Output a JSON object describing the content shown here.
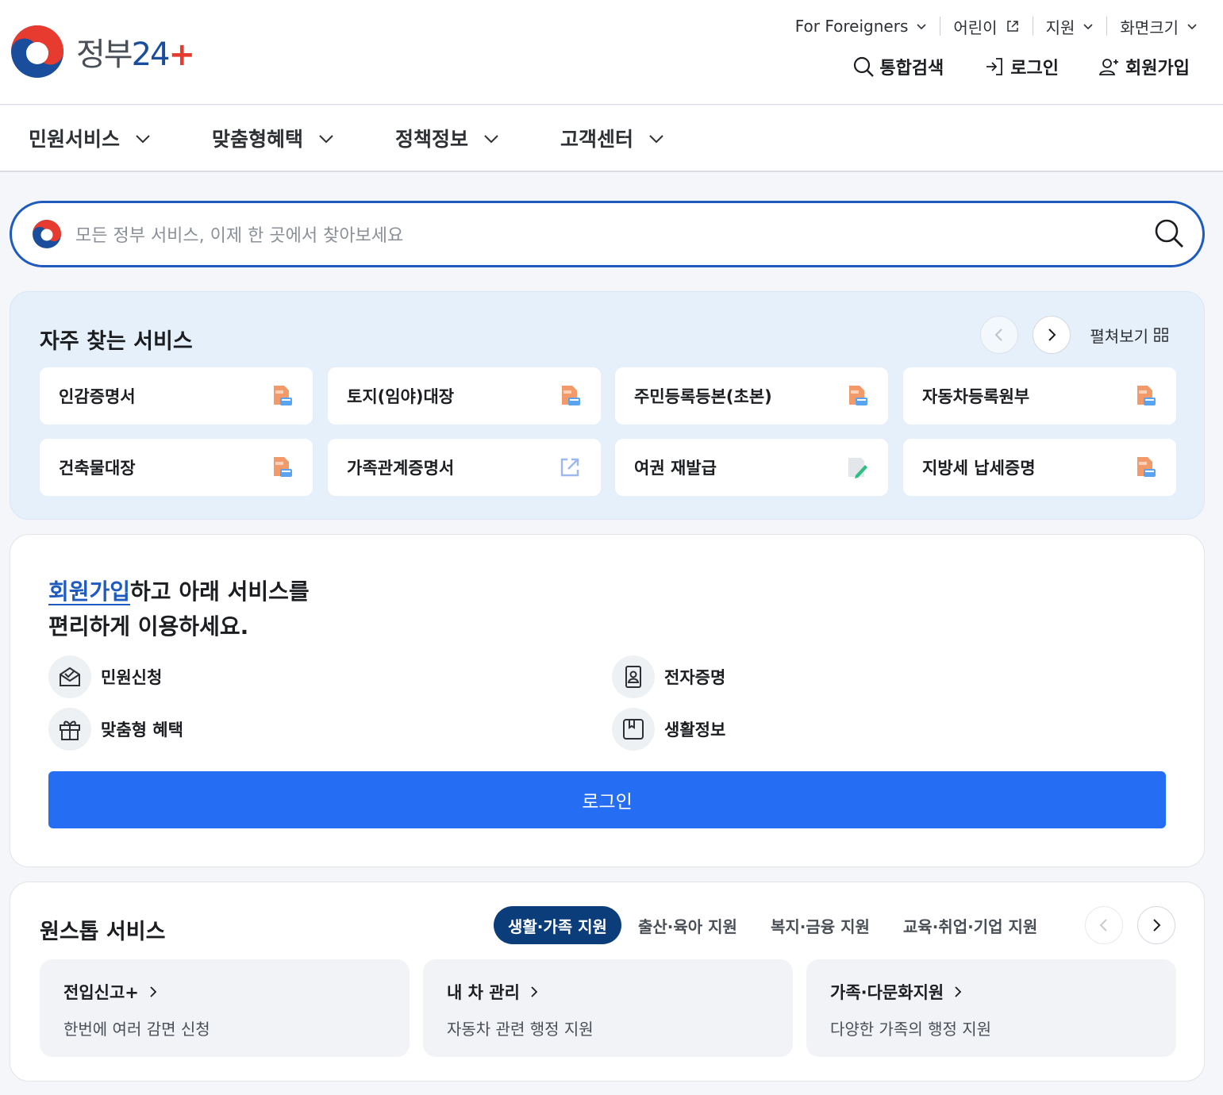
{
  "header": {
    "logo_text_ko": "정부",
    "logo_text_num": "24",
    "logo_text_plus": "+",
    "util": [
      {
        "label": "For Foreigners"
      },
      {
        "label": "어린이"
      },
      {
        "label": "지원"
      },
      {
        "label": "화면크기"
      }
    ],
    "actions": {
      "search": "통합검색",
      "login": "로그인",
      "signup": "회원가입"
    }
  },
  "gnb": [
    "민원서비스",
    "맞춤형혜택",
    "정책정보",
    "고객센터"
  ],
  "search": {
    "placeholder": "모든 정부 서비스, 이제 한 곳에서 찾아보세요"
  },
  "frequent": {
    "title": "자주 찾는 서비스",
    "spread_label": "펼쳐보기",
    "items": [
      {
        "label": "인감증명서",
        "icon": "pdf-icon"
      },
      {
        "label": "토지(임야)대장",
        "icon": "pdf-icon"
      },
      {
        "label": "주민등록등본(초본)",
        "icon": "pdf-icon"
      },
      {
        "label": "자동차등록원부",
        "icon": "pdf-icon"
      },
      {
        "label": "건축물대장",
        "icon": "pdf-icon"
      },
      {
        "label": "가족관계증명서",
        "icon": "external-link-icon"
      },
      {
        "label": "여권 재발급",
        "icon": "edit-icon"
      },
      {
        "label": "지방세 납세증명",
        "icon": "pdf-icon"
      }
    ]
  },
  "signup_panel": {
    "highlight": "회원가입",
    "line1_rest": "하고 아래 서비스를",
    "line2": "편리하게 이용하세요.",
    "features": [
      {
        "label": "민원신청",
        "icon": "mail-icon"
      },
      {
        "label": "전자증명",
        "icon": "id-card-icon"
      },
      {
        "label": "맞춤형 혜택",
        "icon": "gift-icon"
      },
      {
        "label": "생활정보",
        "icon": "bookmark-icon"
      }
    ],
    "login_button": "로그인"
  },
  "onestop": {
    "title": "원스톱 서비스",
    "tabs": [
      "생활·가족 지원",
      "출산·육아 지원",
      "복지·금융 지원",
      "교육·취업·기업 지원"
    ],
    "cards": [
      {
        "title": "전입신고+",
        "sub": "한번에 여러 감면 신청"
      },
      {
        "title": "내 차 관리",
        "sub": "자동차 관련 행정 지원"
      },
      {
        "title": "가족·다문화지원",
        "sub": "다양한 가족의 행정 지원"
      }
    ]
  },
  "colors": {
    "primary": "#256ef4",
    "brand_navy": "#0b3d7a",
    "search_border": "#1f5bbf",
    "frequent_bg": "#e6f0fb"
  }
}
